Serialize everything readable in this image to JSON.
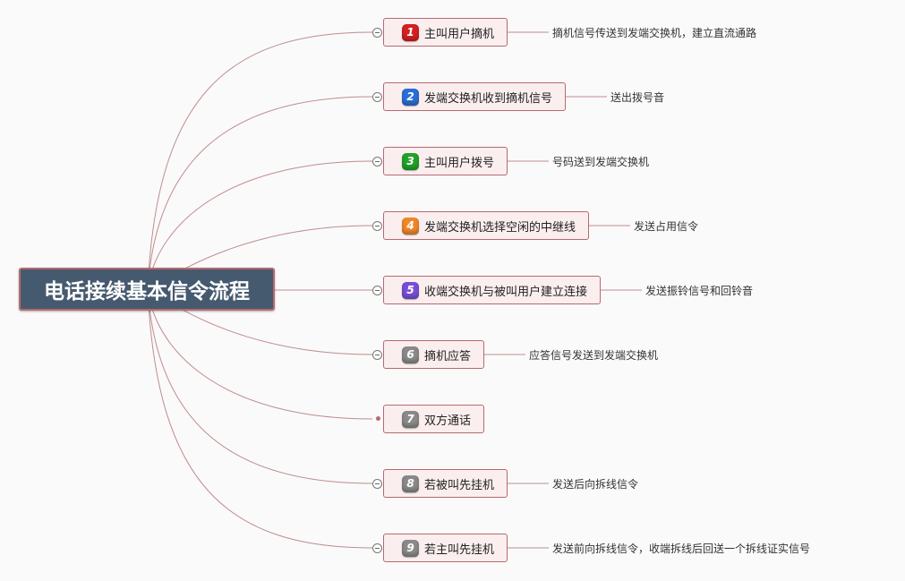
{
  "root": {
    "title": "电话接续基本信令流程"
  },
  "steps": [
    {
      "num": "1",
      "label": "主叫用户摘机",
      "note": "摘机信号传送到发端交换机，建立直流通路",
      "color": "#d42020"
    },
    {
      "num": "2",
      "label": "发端交换机收到摘机信号",
      "note": "送出拨号音",
      "color": "#2a6fd6"
    },
    {
      "num": "3",
      "label": "主叫用户拨号",
      "note": "号码送到发端交换机",
      "color": "#22a22a"
    },
    {
      "num": "4",
      "label": "发端交换机选择空闲的中继线",
      "note": "发送占用信令",
      "color": "#f0882a"
    },
    {
      "num": "5",
      "label": "收端交换机与被叫用户建立连接",
      "note": "发送振铃信号和回铃音",
      "color": "#7a4fd6"
    },
    {
      "num": "6",
      "label": "摘机应答",
      "note": "应答信号发送到发端交换机",
      "color": "#8a8a8a"
    },
    {
      "num": "7",
      "label": "双方通话",
      "note": "",
      "color": "#8a8a8a"
    },
    {
      "num": "8",
      "label": "若被叫先挂机",
      "note": "发送后向拆线信令",
      "color": "#8a8a8a"
    },
    {
      "num": "9",
      "label": "若主叫先挂机",
      "note": "发送前向拆线信令，收端拆线后回送一个拆线证实信号",
      "color": "#8a8a8a"
    }
  ]
}
